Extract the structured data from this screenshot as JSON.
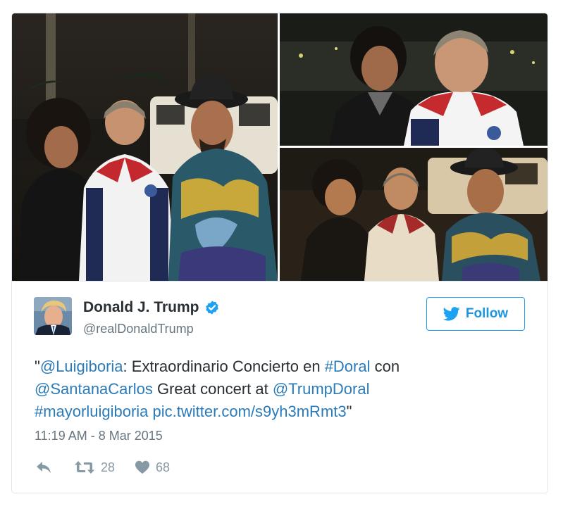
{
  "tweet": {
    "display_name": "Donald J. Trump",
    "handle": "@realDonaldTrump",
    "follow_label": "Follow",
    "text": {
      "open_quote": "\"",
      "mention_1": "@Luigiboria",
      "part_1": ": Extraordinario Concierto en ",
      "hashtag_1": "#Doral",
      "part_2": " con ",
      "mention_2": "@SantanaCarlos",
      "part_3": " Great concert at ",
      "mention_3": "@TrumpDoral",
      "hashtag_2": "#mayorluigiboria",
      "link": "pic.twitter.com/s9yh3mRmt3",
      "close_quote": "\""
    },
    "timestamp": "11:19 AM - 8 Mar 2015",
    "retweet_count": "28",
    "like_count": "68"
  },
  "colors": {
    "link": "#2b7bb9",
    "follow_blue": "#1da1f2",
    "verified_blue": "#1da1f2",
    "secondary_text": "#66757f",
    "action_icon": "#8899a6",
    "border": "#e1e8ed"
  },
  "icons": [
    "verified-badge-icon",
    "twitter-bird-icon",
    "reply-icon",
    "retweet-icon",
    "heart-icon"
  ]
}
